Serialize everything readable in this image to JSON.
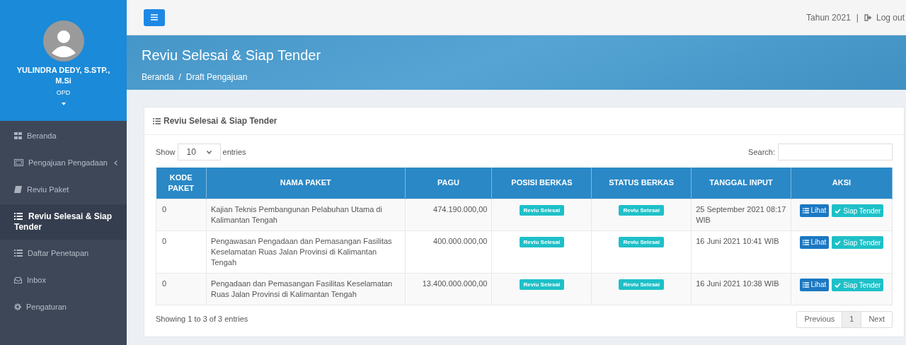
{
  "user": {
    "name": "YULINDRA DEDY, S.STP., M.Si",
    "role": "OPD"
  },
  "sidebar": {
    "items": [
      {
        "label": "Beranda",
        "kind": "link",
        "selected": false
      },
      {
        "label": "Pengajuan Pengadaan",
        "kind": "submenu",
        "selected": false
      },
      {
        "label": "Reviu Paket",
        "kind": "link",
        "selected": false
      },
      {
        "label": "Reviu Selesai & Siap Tender",
        "kind": "link",
        "selected": true
      },
      {
        "label": "Daftar Penetapan",
        "kind": "link",
        "selected": false
      },
      {
        "label": "Inbox",
        "kind": "link",
        "selected": false
      },
      {
        "label": "Pengaturan",
        "kind": "link",
        "selected": false
      }
    ]
  },
  "topbar": {
    "year": "Tahun 2021",
    "separator": "|",
    "logout": "Log out"
  },
  "header": {
    "title": "Reviu Selesai & Siap Tender",
    "breadcrumb": [
      "Beranda",
      "Draft Pengajuan"
    ],
    "breadcrumb_separator": "/"
  },
  "card": {
    "title": "Reviu Selesai & Siap Tender",
    "length": {
      "before": "Show",
      "value": "10",
      "after": "entries"
    },
    "search": {
      "label": "Search:"
    },
    "table": {
      "columns": [
        "KODE PAKET",
        "NAMA PAKET",
        "PAGU",
        "POSISI BERKAS",
        "STATUS BERKAS",
        "TANGGAL INPUT",
        "AKSI"
      ],
      "rows": [
        {
          "kode": "0",
          "nama": "Kajian Teknis Pembangunan Pelabuhan Utama di Kalimantan Tengah",
          "pagu": "474.190.000,00",
          "posisi": "Reviu Selesai",
          "status": "Reviu Selesai",
          "tanggal": "25 September 2021 08:17 WIB",
          "actions": [
            "Lihat",
            "Siap Tender"
          ]
        },
        {
          "kode": "0",
          "nama": "Pengawasan Pengadaan dan Pemasangan Fasilitas Keselamatan Ruas Jalan Provinsi di Kalimantan Tengah",
          "pagu": "400.000.000,00",
          "posisi": "Reviu Selesai",
          "status": "Reviu Selesai",
          "tanggal": "16 Juni 2021 10:41 WIB",
          "actions": [
            "Lihat",
            "Siap Tender"
          ]
        },
        {
          "kode": "0",
          "nama": "Pengadaan dan Pemasangan Fasilitas Keselamatan Ruas Jalan Provinsi di Kalimantan Tengah",
          "pagu": "13.400.000.000,00",
          "posisi": "Reviu Selesai",
          "status": "Reviu Selesai",
          "tanggal": "16 Juni 2021 10:38 WIB",
          "actions": [
            "Lihat",
            "Siap Tender"
          ]
        }
      ]
    },
    "info": "Showing 1 to 3 of 3 entries",
    "pagination": [
      {
        "label": "Previous",
        "selected": false
      },
      {
        "label": "1",
        "selected": true
      },
      {
        "label": "Next",
        "selected": false
      }
    ]
  }
}
